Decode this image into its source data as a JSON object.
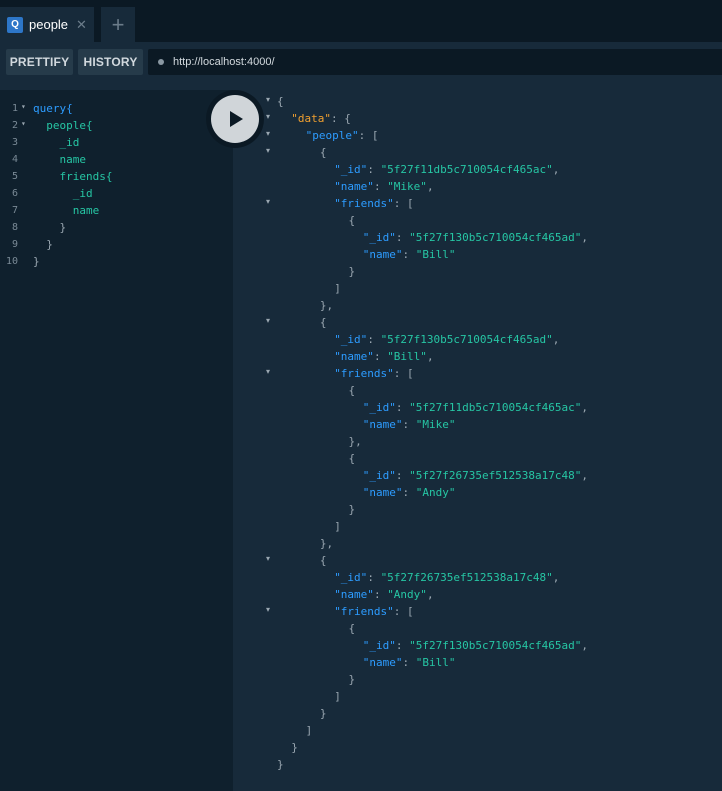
{
  "tab": {
    "letter": "Q",
    "title": "people",
    "close": "✕",
    "add": "+"
  },
  "toolbar": {
    "prettify": "PRETTIFY",
    "history": "HISTORY",
    "url": "http://localhost:4000/"
  },
  "query_lines": [
    {
      "num": "1",
      "fold": "▾",
      "text": "query{"
    },
    {
      "num": "2",
      "fold": "▾",
      "text": "  people{"
    },
    {
      "num": "3",
      "fold": "",
      "text": "    _id"
    },
    {
      "num": "4",
      "fold": "",
      "text": "    name"
    },
    {
      "num": "5",
      "fold": "",
      "text": "    friends{"
    },
    {
      "num": "6",
      "fold": "",
      "text": "      _id"
    },
    {
      "num": "7",
      "fold": "",
      "text": "      name"
    },
    {
      "num": "8",
      "fold": "",
      "text": "    }"
    },
    {
      "num": "9",
      "fold": "",
      "text": "  }"
    },
    {
      "num": "10",
      "fold": "",
      "text": "}"
    }
  ],
  "result_lines": [
    {
      "indent": 0,
      "text": "{",
      "fold": "▾"
    },
    {
      "indent": 1,
      "key": "data",
      "text": ": {",
      "fold": "▾",
      "special": "data"
    },
    {
      "indent": 2,
      "key": "people",
      "text": ": [",
      "fold": "▾"
    },
    {
      "indent": 3,
      "text": "{",
      "fold": "▾"
    },
    {
      "indent": 4,
      "key": "_id",
      "value": "5f27f11db5c710054cf465ac",
      "text": ","
    },
    {
      "indent": 4,
      "key": "name",
      "value": "Mike",
      "text": ","
    },
    {
      "indent": 4,
      "key": "friends",
      "text": ": [",
      "fold": "▾"
    },
    {
      "indent": 5,
      "text": "{"
    },
    {
      "indent": 6,
      "key": "_id",
      "value": "5f27f130b5c710054cf465ad",
      "text": ","
    },
    {
      "indent": 6,
      "key": "name",
      "value": "Bill",
      "text": ""
    },
    {
      "indent": 5,
      "text": "}"
    },
    {
      "indent": 4,
      "text": "]"
    },
    {
      "indent": 3,
      "text": "},"
    },
    {
      "indent": 3,
      "text": "{",
      "fold": "▾"
    },
    {
      "indent": 4,
      "key": "_id",
      "value": "5f27f130b5c710054cf465ad",
      "text": ","
    },
    {
      "indent": 4,
      "key": "name",
      "value": "Bill",
      "text": ","
    },
    {
      "indent": 4,
      "key": "friends",
      "text": ": [",
      "fold": "▾"
    },
    {
      "indent": 5,
      "text": "{"
    },
    {
      "indent": 6,
      "key": "_id",
      "value": "5f27f11db5c710054cf465ac",
      "text": ","
    },
    {
      "indent": 6,
      "key": "name",
      "value": "Mike",
      "text": ""
    },
    {
      "indent": 5,
      "text": "},"
    },
    {
      "indent": 5,
      "text": "{"
    },
    {
      "indent": 6,
      "key": "_id",
      "value": "5f27f26735ef512538a17c48",
      "text": ","
    },
    {
      "indent": 6,
      "key": "name",
      "value": "Andy",
      "text": ""
    },
    {
      "indent": 5,
      "text": "}"
    },
    {
      "indent": 4,
      "text": "]"
    },
    {
      "indent": 3,
      "text": "},"
    },
    {
      "indent": 3,
      "text": "{",
      "fold": "▾"
    },
    {
      "indent": 4,
      "key": "_id",
      "value": "5f27f26735ef512538a17c48",
      "text": ","
    },
    {
      "indent": 4,
      "key": "name",
      "value": "Andy",
      "text": ","
    },
    {
      "indent": 4,
      "key": "friends",
      "text": ": [",
      "fold": "▾"
    },
    {
      "indent": 5,
      "text": "{"
    },
    {
      "indent": 6,
      "key": "_id",
      "value": "5f27f130b5c710054cf465ad",
      "text": ","
    },
    {
      "indent": 6,
      "key": "name",
      "value": "Bill",
      "text": ""
    },
    {
      "indent": 5,
      "text": "}"
    },
    {
      "indent": 4,
      "text": "]"
    },
    {
      "indent": 3,
      "text": "}"
    },
    {
      "indent": 2,
      "text": "]"
    },
    {
      "indent": 1,
      "text": "}"
    },
    {
      "indent": 0,
      "text": "}"
    }
  ],
  "colors": {
    "background": "#172a3a",
    "editor_bg": "#0f202d",
    "key": "#2d9cff",
    "string": "#26c6a4",
    "data_key": "#f0a030"
  }
}
